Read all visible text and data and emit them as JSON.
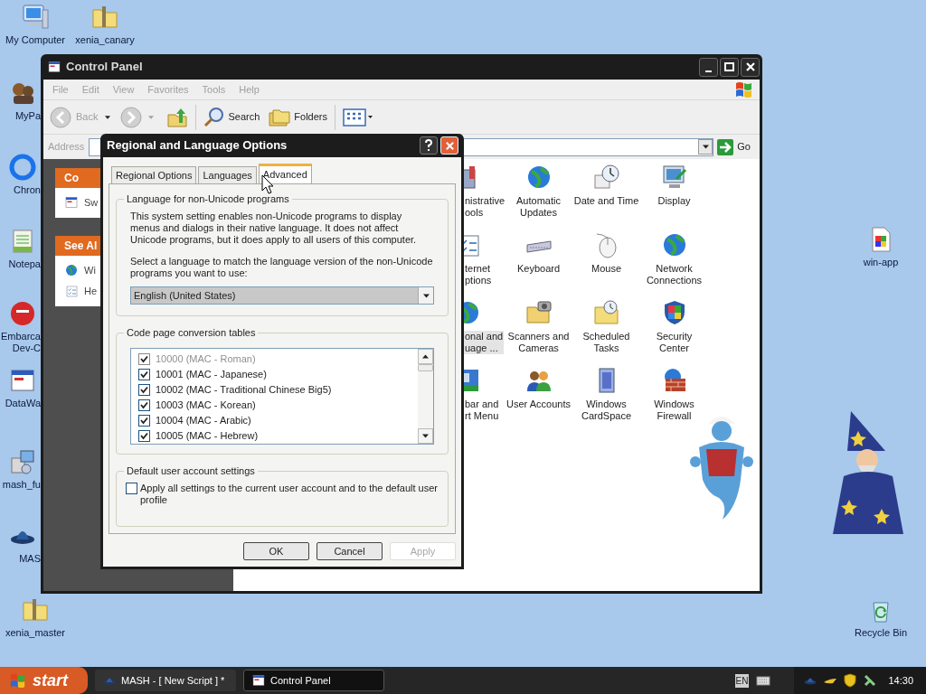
{
  "desktop_icons": [
    {
      "label": "My Computer"
    },
    {
      "label": "xenia_canary"
    },
    {
      "label": "MyPa"
    },
    {
      "label": "Chron"
    },
    {
      "label": "Notepa"
    },
    {
      "label": "Embarca\nDev-C"
    },
    {
      "label": "DataWa"
    },
    {
      "label": "mash_fu"
    },
    {
      "label": "MAS"
    },
    {
      "label": "xenia_master"
    },
    {
      "label": "win-app"
    },
    {
      "label": "Recycle Bin"
    }
  ],
  "control_panel": {
    "title": "Control Panel",
    "menu": [
      "File",
      "Edit",
      "View",
      "Favorites",
      "Tools",
      "Help"
    ],
    "toolbar": {
      "back": "Back",
      "search": "Search",
      "folders": "Folders"
    },
    "address_label": "Address",
    "go": "Go",
    "task_panes": [
      {
        "title": "Co",
        "items": [
          "Sw"
        ]
      },
      {
        "title": "See Al",
        "items": [
          "Wi",
          "He"
        ]
      }
    ],
    "applet_rows": [
      [
        {
          "label": "nistrative\nools",
          "selected": false
        },
        {
          "label": "Automatic Updates",
          "selected": false
        },
        {
          "label": "Date and Time",
          "selected": false
        },
        {
          "label": "Display",
          "selected": false
        }
      ],
      [
        {
          "label": "ternet\nptions",
          "selected": false
        },
        {
          "label": "Keyboard",
          "selected": false
        },
        {
          "label": "Mouse",
          "selected": false
        },
        {
          "label": "Network Connections",
          "selected": false
        }
      ],
      [
        {
          "label": "onal and\nuage ...",
          "selected": true
        },
        {
          "label": "Scanners and Cameras",
          "selected": false
        },
        {
          "label": "Scheduled Tasks",
          "selected": false
        },
        {
          "label": "Security Center",
          "selected": false
        }
      ],
      [
        {
          "label": "bar and\nrt Menu",
          "selected": false
        },
        {
          "label": "User Accounts",
          "selected": false
        },
        {
          "label": "Windows CardSpace",
          "selected": false
        },
        {
          "label": "Windows Firewall",
          "selected": false
        }
      ]
    ]
  },
  "dialog": {
    "title": "Regional and Language Options",
    "tabs": [
      {
        "label": "Regional Options",
        "selected": false
      },
      {
        "label": "Languages",
        "selected": false
      },
      {
        "label": "Advanced",
        "selected": true
      }
    ],
    "non_unicode": {
      "legend": "Language for non-Unicode programs",
      "description": "This system setting enables non-Unicode programs to display menus and dialogs in their native language. It does not affect Unicode programs, but it does apply to all users of this computer.",
      "prompt": "Select a language to match the language version of the non-Unicode programs you want to use:",
      "language": "English (United States)",
      "disabled": true
    },
    "code_pages": {
      "legend": "Code page conversion tables",
      "items": [
        {
          "label": "10000 (MAC - Roman)",
          "checked": true,
          "disabled": true
        },
        {
          "label": "10001 (MAC - Japanese)",
          "checked": true,
          "disabled": false
        },
        {
          "label": "10002 (MAC - Traditional Chinese Big5)",
          "checked": true,
          "disabled": false
        },
        {
          "label": "10003 (MAC - Korean)",
          "checked": true,
          "disabled": false
        },
        {
          "label": "10004 (MAC - Arabic)",
          "checked": true,
          "disabled": false
        },
        {
          "label": "10005 (MAC - Hebrew)",
          "checked": true,
          "disabled": false
        }
      ]
    },
    "default_user": {
      "legend": "Default user account settings",
      "label": "Apply all settings to the current user account and to the default user profile",
      "checked": false
    },
    "buttons": [
      {
        "label": "OK",
        "disabled": false
      },
      {
        "label": "Cancel",
        "disabled": false
      },
      {
        "label": "Apply",
        "disabled": true
      }
    ]
  },
  "taskbar": {
    "start": "start",
    "tasks": [
      {
        "label": "MASH - [ New Script ] *",
        "selected": false
      },
      {
        "label": "Control Panel",
        "selected": true
      }
    ],
    "language": "EN",
    "clock": "14:30"
  }
}
